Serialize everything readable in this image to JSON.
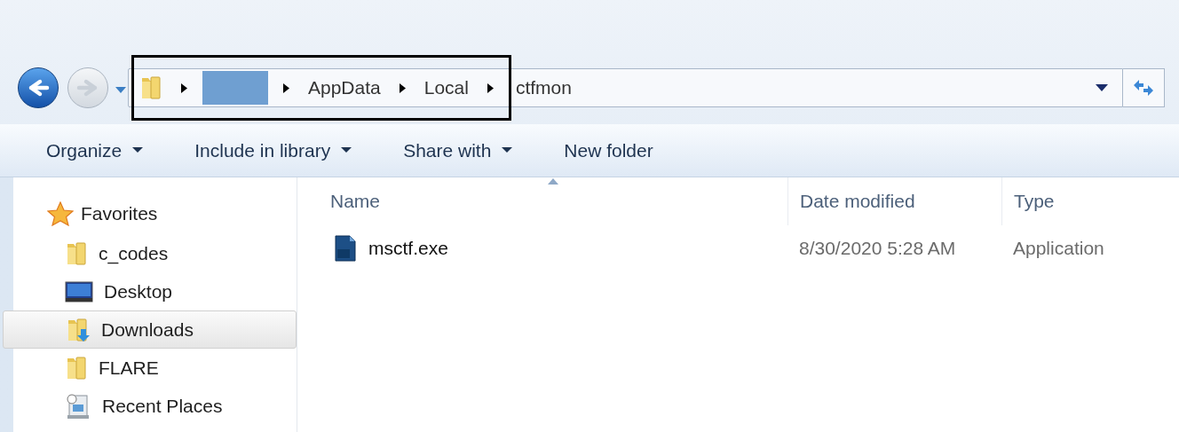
{
  "nav_buttons": [
    {
      "kind": "back",
      "disabled": false
    },
    {
      "kind": "forward",
      "disabled": true
    }
  ],
  "address_bar": {
    "crumbs": [
      {
        "kind": "redacted"
      },
      {
        "kind": "text",
        "label": "AppData"
      },
      {
        "kind": "text",
        "label": "Local"
      }
    ],
    "current": "ctfmon"
  },
  "toolbar": [
    {
      "label": "Organize",
      "dropdown": true
    },
    {
      "label": "Include in library",
      "dropdown": true
    },
    {
      "label": "Share with",
      "dropdown": true
    },
    {
      "label": "New folder",
      "dropdown": false
    }
  ],
  "sidebar": {
    "header": "Favorites",
    "items": [
      {
        "kind": "folder",
        "label": "c_codes",
        "selected": false
      },
      {
        "kind": "desktop",
        "label": "Desktop",
        "selected": false
      },
      {
        "kind": "downloads",
        "label": "Downloads",
        "selected": true
      },
      {
        "kind": "folder",
        "label": "FLARE",
        "selected": false
      },
      {
        "kind": "recent",
        "label": "Recent Places",
        "selected": false
      }
    ]
  },
  "table": {
    "columns": [
      {
        "label": "Name",
        "sorted": true
      },
      {
        "label": "Date modified",
        "sorted": false
      },
      {
        "label": "Type",
        "sorted": false
      }
    ],
    "rows": [
      {
        "name": "msctf.exe",
        "date_modified": "8/30/2020 5:28 AM",
        "type": "Application"
      }
    ]
  }
}
